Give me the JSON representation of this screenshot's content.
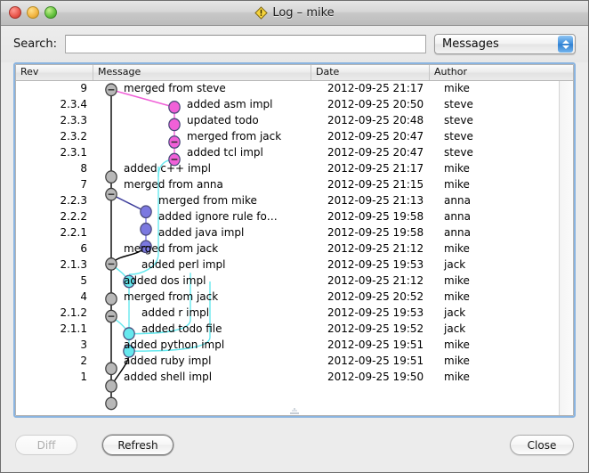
{
  "window": {
    "title": "Log – mike",
    "app_icon": "warning-diamond-icon",
    "traffic_lights": [
      "close-button",
      "minimize-button",
      "zoom-button"
    ]
  },
  "search": {
    "label": "Search:",
    "value": "",
    "placeholder": ""
  },
  "filter": {
    "selected": "Messages"
  },
  "table": {
    "columns": [
      {
        "key": "rev",
        "label": "Rev"
      },
      {
        "key": "message",
        "label": "Message"
      },
      {
        "key": "date",
        "label": "Date"
      },
      {
        "key": "author",
        "label": "Author"
      }
    ],
    "rows": [
      {
        "rev": "9",
        "message": "merged from steve",
        "date": "2012-09-25 21:17",
        "author": "mike",
        "lane": 0,
        "node": "minus",
        "color": "#b8b8b8"
      },
      {
        "rev": "2.3.4",
        "message": "added asm impl",
        "date": "2012-09-25 20:50",
        "author": "steve",
        "lane": 3,
        "node": "dot",
        "color": "#f060d8"
      },
      {
        "rev": "2.3.3",
        "message": "updated todo",
        "date": "2012-09-25 20:48",
        "author": "steve",
        "lane": 3,
        "node": "dot",
        "color": "#f060d8"
      },
      {
        "rev": "2.3.2",
        "message": "merged from jack",
        "date": "2012-09-25 20:47",
        "author": "steve",
        "lane": 3,
        "node": "minus",
        "color": "#f060d8"
      },
      {
        "rev": "2.3.1",
        "message": "added tcl impl",
        "date": "2012-09-25 20:47",
        "author": "steve",
        "lane": 3,
        "node": "minus",
        "color": "#f060d8"
      },
      {
        "rev": "8",
        "message": "added c++ impl",
        "date": "2012-09-25 21:17",
        "author": "mike",
        "lane": 0,
        "node": "dot",
        "color": "#b8b8b8"
      },
      {
        "rev": "7",
        "message": "merged from anna",
        "date": "2012-09-25 21:15",
        "author": "mike",
        "lane": 0,
        "node": "minus",
        "color": "#b8b8b8"
      },
      {
        "rev": "2.2.3",
        "message": "merged from mike",
        "date": "2012-09-25 21:13",
        "author": "anna",
        "lane": 2,
        "node": "dot",
        "color": "#7b78e0"
      },
      {
        "rev": "2.2.2",
        "message": "added ignore rule fo…",
        "date": "2012-09-25 19:58",
        "author": "anna",
        "lane": 2,
        "node": "dot",
        "color": "#7b78e0"
      },
      {
        "rev": "2.2.1",
        "message": "added java impl",
        "date": "2012-09-25 19:58",
        "author": "anna",
        "lane": 2,
        "node": "minus",
        "color": "#7b78e0"
      },
      {
        "rev": "6",
        "message": "merged from jack",
        "date": "2012-09-25 21:12",
        "author": "mike",
        "lane": 0,
        "node": "minus",
        "color": "#b8b8b8"
      },
      {
        "rev": "2.1.3",
        "message": "added perl impl",
        "date": "2012-09-25 19:53",
        "author": "jack",
        "lane": 1,
        "node": "dot",
        "color": "#66e8ee"
      },
      {
        "rev": "5",
        "message": "added dos impl",
        "date": "2012-09-25 21:12",
        "author": "mike",
        "lane": 0,
        "node": "dot",
        "color": "#b8b8b8"
      },
      {
        "rev": "4",
        "message": "merged from jack",
        "date": "2012-09-25 20:52",
        "author": "mike",
        "lane": 0,
        "node": "minus",
        "color": "#b8b8b8"
      },
      {
        "rev": "2.1.2",
        "message": "added r impl",
        "date": "2012-09-25 19:53",
        "author": "jack",
        "lane": 1,
        "node": "dot",
        "color": "#66e8ee"
      },
      {
        "rev": "2.1.1",
        "message": "added todo file",
        "date": "2012-09-25 19:52",
        "author": "jack",
        "lane": 1,
        "node": "dot",
        "color": "#66e8ee"
      },
      {
        "rev": "3",
        "message": "added python impl",
        "date": "2012-09-25 19:51",
        "author": "mike",
        "lane": 0,
        "node": "dot",
        "color": "#b8b8b8"
      },
      {
        "rev": "2",
        "message": "added ruby impl",
        "date": "2012-09-25 19:51",
        "author": "mike",
        "lane": 0,
        "node": "dot",
        "color": "#b8b8b8"
      },
      {
        "rev": "1",
        "message": "added shell impl",
        "date": "2012-09-25 19:50",
        "author": "mike",
        "lane": 0,
        "node": "dot",
        "color": "#b8b8b8"
      }
    ]
  },
  "buttons": {
    "diff": "Diff",
    "refresh": "Refresh",
    "close": "Close"
  },
  "colors": {
    "lane_trunk": "#b8b8b8",
    "lane_jack": "#66e8ee",
    "lane_anna": "#7b78e0",
    "lane_steve": "#f060d8",
    "focus_ring": "#8ab4e0"
  }
}
